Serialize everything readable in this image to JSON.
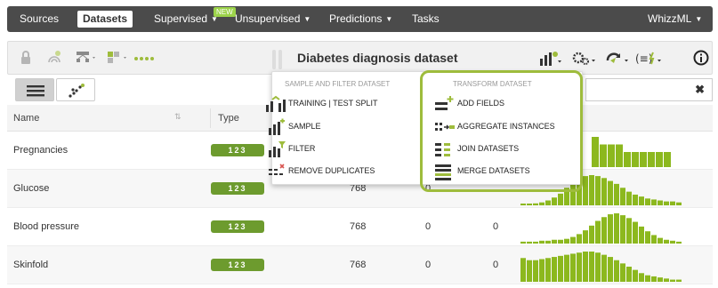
{
  "topnav": {
    "items": [
      "Sources",
      "Datasets",
      "Supervised",
      "Unsupervised",
      "Predictions",
      "Tasks"
    ],
    "new_badge": "NEW",
    "user_menu": "WhizzML"
  },
  "toolbar": {
    "dataset_title": "Diabetes diagnosis dataset",
    "icons": [
      "lock-icon",
      "fingerprint-icon",
      "network-icon",
      "scriptify-icon",
      "dots-icon",
      "dataset-actions-icon",
      "configure-icon",
      "refresh-icon",
      "formula-icon",
      "info-icon"
    ]
  },
  "table": {
    "headers": {
      "name": "Name",
      "type": "Type"
    },
    "rows": [
      {
        "name": "Pregnancies",
        "type": "123",
        "count": "",
        "missing": "",
        "errors": "",
        "hist": [
          4,
          3,
          3,
          3,
          2,
          2,
          2,
          2,
          2,
          2
        ]
      },
      {
        "name": "Glucose",
        "type": "123",
        "count": "768",
        "missing": "0",
        "errors": "",
        "hist": [
          1,
          1,
          2,
          3,
          5,
          8,
          12,
          18,
          24,
          28,
          30,
          31,
          30,
          28,
          25,
          22,
          18,
          14,
          11,
          9,
          7,
          6,
          5,
          4,
          4,
          3
        ]
      },
      {
        "name": "Blood pressure",
        "type": "123",
        "count": "768",
        "missing": "0",
        "errors": "0",
        "hist": [
          2,
          2,
          2,
          3,
          3,
          4,
          4,
          5,
          7,
          10,
          14,
          19,
          24,
          28,
          31,
          32,
          30,
          27,
          23,
          18,
          13,
          9,
          6,
          4,
          3,
          2
        ]
      },
      {
        "name": "Skinfold",
        "type": "123",
        "count": "768",
        "missing": "0",
        "errors": "0",
        "hist": [
          22,
          20,
          20,
          21,
          22,
          23,
          24,
          25,
          26,
          27,
          28,
          28,
          27,
          25,
          23,
          20,
          17,
          14,
          11,
          8,
          6,
          5,
          4,
          3,
          2,
          2
        ]
      }
    ]
  },
  "menu": {
    "left_heading": "SAMPLE AND FILTER DATASET",
    "right_heading": "TRANSFORM DATASET",
    "left_items": [
      "TRAINING | TEST SPLIT",
      "SAMPLE",
      "FILTER",
      "REMOVE DUPLICATES"
    ],
    "right_items": [
      "ADD FIELDS",
      "AGGREGATE INSTANCES",
      "JOIN DATASETS",
      "MERGE DATASETS"
    ]
  },
  "colors": {
    "nav_bg": "#4b4b4b",
    "accent_green": "#6d9b2e",
    "highlight_frame": "#9ebc3c",
    "histogram": "#8cb81e"
  }
}
